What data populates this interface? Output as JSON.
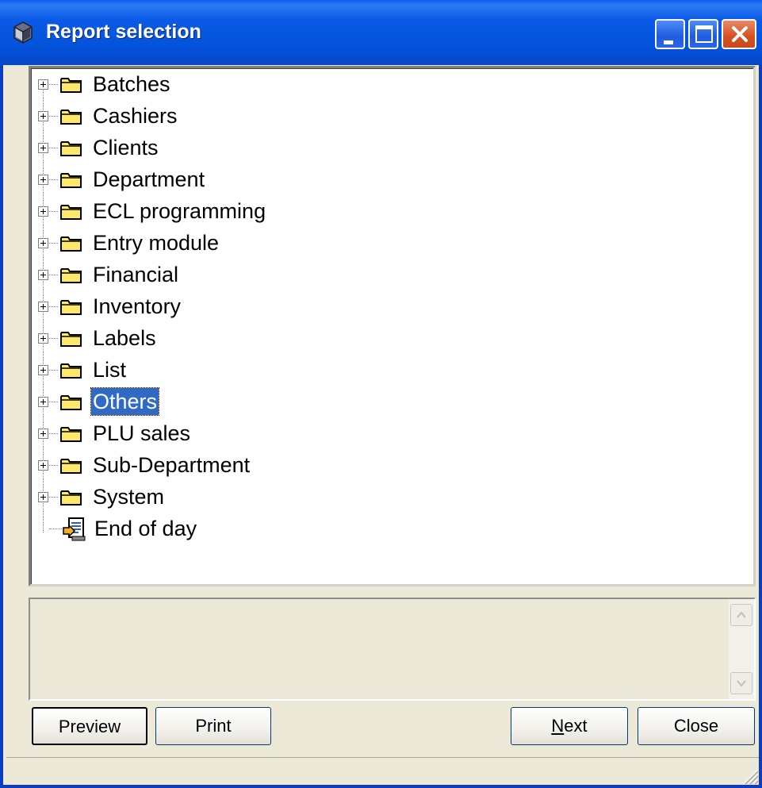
{
  "window": {
    "title": "Report selection",
    "controls": {
      "minimize": "minimize",
      "maximize": "maximize",
      "close": "close"
    }
  },
  "tree": {
    "items": [
      {
        "label": "Batches",
        "type": "folder",
        "expandable": true,
        "selected": false
      },
      {
        "label": "Cashiers",
        "type": "folder",
        "expandable": true,
        "selected": false
      },
      {
        "label": "Clients",
        "type": "folder",
        "expandable": true,
        "selected": false
      },
      {
        "label": "Department",
        "type": "folder",
        "expandable": true,
        "selected": false
      },
      {
        "label": "ECL programming",
        "type": "folder",
        "expandable": true,
        "selected": false
      },
      {
        "label": "Entry module",
        "type": "folder",
        "expandable": true,
        "selected": false
      },
      {
        "label": "Financial",
        "type": "folder",
        "expandable": true,
        "selected": false
      },
      {
        "label": "Inventory",
        "type": "folder",
        "expandable": true,
        "selected": false
      },
      {
        "label": "Labels",
        "type": "folder",
        "expandable": true,
        "selected": false
      },
      {
        "label": "List",
        "type": "folder",
        "expandable": true,
        "selected": false
      },
      {
        "label": "Others",
        "type": "folder",
        "expandable": true,
        "selected": true
      },
      {
        "label": "PLU sales",
        "type": "folder",
        "expandable": true,
        "selected": false
      },
      {
        "label": "Sub-Department",
        "type": "folder",
        "expandable": true,
        "selected": false
      },
      {
        "label": "System",
        "type": "folder",
        "expandable": true,
        "selected": false
      },
      {
        "label": "End of day",
        "type": "report",
        "expandable": false,
        "selected": false
      }
    ]
  },
  "buttons": {
    "preview": "Preview",
    "print": "Print",
    "next_mnemonic": "N",
    "next_rest": "ext",
    "close": "Close"
  },
  "colors": {
    "selection": "#316AC5",
    "titlebar": "#0A5AE6",
    "face": "#ECE9D8"
  }
}
